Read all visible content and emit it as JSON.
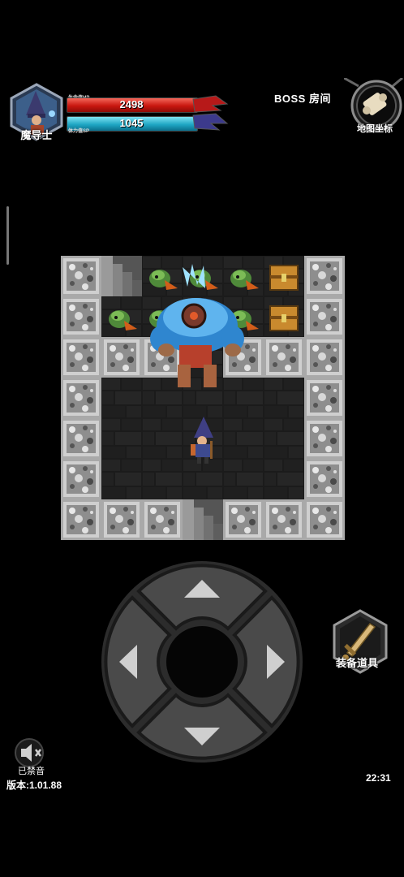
{
  "player": {
    "class_name": "魔导士",
    "hp_label": "生命值HP",
    "hp": "2498",
    "sp_label": "体力值SP",
    "sp": "1045"
  },
  "room": {
    "name": "BOSS  房间"
  },
  "map_button": {
    "label": "地图坐标",
    "icon": "scroll-icon"
  },
  "equipment_button": {
    "label": "装备道具",
    "icon": "sword-icon"
  },
  "sound": {
    "label": "已禁音",
    "icon": "muted-speaker-icon"
  },
  "version": "版本:1.01.88",
  "clock": "22:31",
  "dpad": {
    "up_icon": "arrow-up-icon",
    "down_icon": "arrow-down-icon",
    "left_icon": "arrow-left-icon",
    "right_icon": "arrow-right-icon"
  },
  "colors": {
    "hp": "#c9170f",
    "sp": "#1fa6c4",
    "boss": "#3a9ce0",
    "chest": "#c98a2e"
  }
}
